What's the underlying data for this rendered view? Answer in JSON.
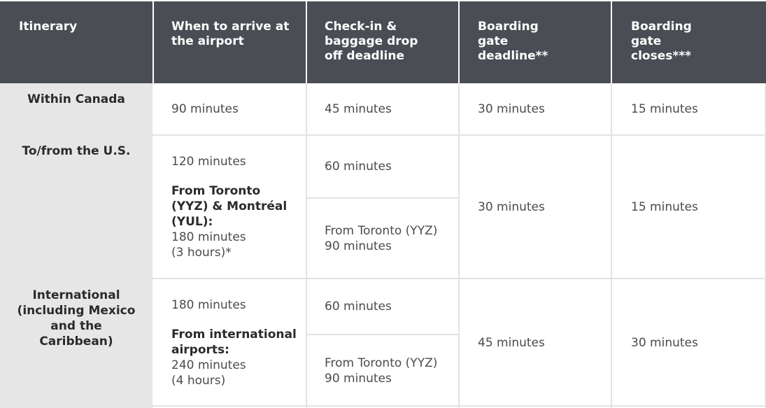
{
  "table": {
    "headers": [
      "Itinerary",
      "When to arrive at the airport",
      "Check-in & baggage drop off deadline",
      "Boarding gate deadline**",
      "Boarding gate closes***"
    ],
    "rows": [
      {
        "itinerary": "Within Canada",
        "arrive": {
          "value": "90 minutes"
        },
        "checkin": [
          {
            "value": "45 minutes"
          }
        ],
        "gate_deadline": "30 minutes",
        "gate_closes": "15 minutes"
      },
      {
        "itinerary": "To/from the U.S.",
        "arrive": {
          "value": "120 minutes",
          "note_label": "From Toronto (YYZ) & Montréal (YUL):",
          "note_value": "180 minutes",
          "note_extra": "(3 hours)*"
        },
        "checkin": [
          {
            "value": "60 minutes"
          },
          {
            "label": "From Toronto (YYZ)",
            "value": "90 minutes"
          }
        ],
        "gate_deadline": "30 minutes",
        "gate_closes": "15 minutes"
      },
      {
        "itinerary": "International (including Mexico and the Caribbean)",
        "arrive": {
          "value": "180 minutes",
          "note_label": "From international airports:",
          "note_value": "240 minutes",
          "note_extra": "(4 hours)"
        },
        "checkin": [
          {
            "value": "60 minutes"
          },
          {
            "label": "From Toronto (YYZ)",
            "value": "90 minutes"
          }
        ],
        "gate_deadline": "45 minutes",
        "gate_closes": "30 minutes"
      }
    ]
  }
}
